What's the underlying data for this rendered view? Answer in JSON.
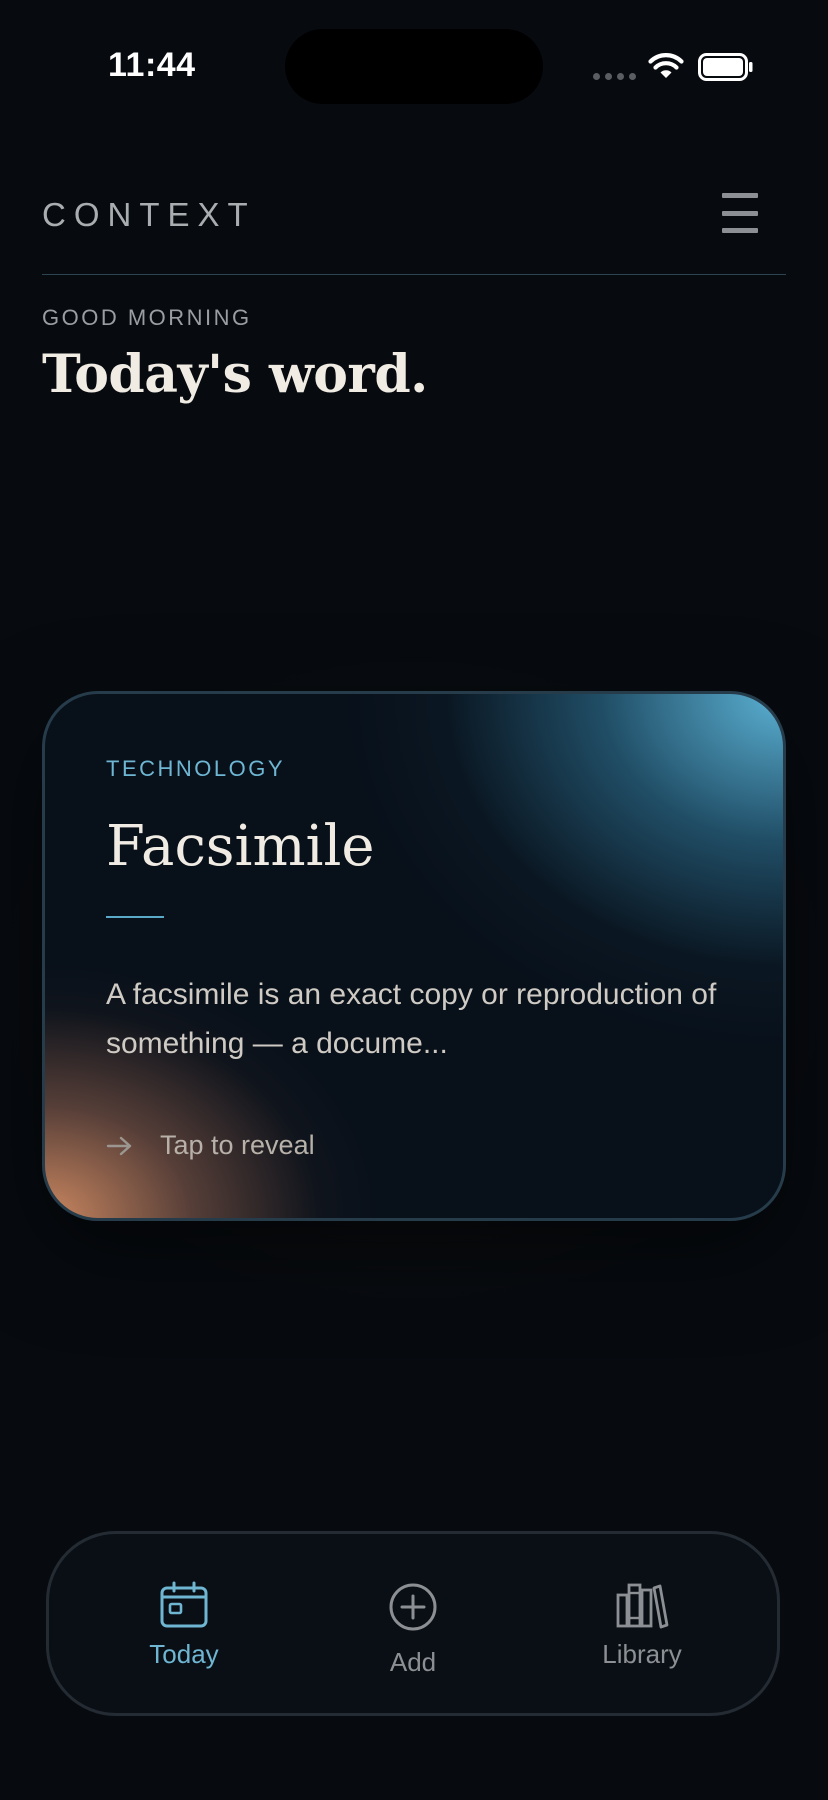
{
  "status_bar": {
    "time": "11:44"
  },
  "header": {
    "brand": "CONTEXT",
    "menu_icon": "hamburger-menu-icon"
  },
  "intro": {
    "greeting": "GOOD MORNING",
    "title": "Today's word."
  },
  "word_card": {
    "category": "TECHNOLOGY",
    "word": "Facsimile",
    "definition": "A facsimile is an exact copy or reproduction of something — a docume...",
    "cta_label": "Tap to reveal",
    "cta_icon": "arrow-right-icon"
  },
  "tab_bar": {
    "items": [
      {
        "label": "Today",
        "icon": "calendar-icon",
        "active": true
      },
      {
        "label": "Add",
        "icon": "plus-circle-icon",
        "active": false
      },
      {
        "label": "Library",
        "icon": "books-icon",
        "active": false
      }
    ]
  },
  "colors": {
    "background": "#070b10",
    "accent": "#6fb6d3",
    "text_primary": "#f1ece3",
    "text_muted": "#8c9094",
    "card_warm": "#d68e64",
    "card_cool": "#60bade"
  }
}
